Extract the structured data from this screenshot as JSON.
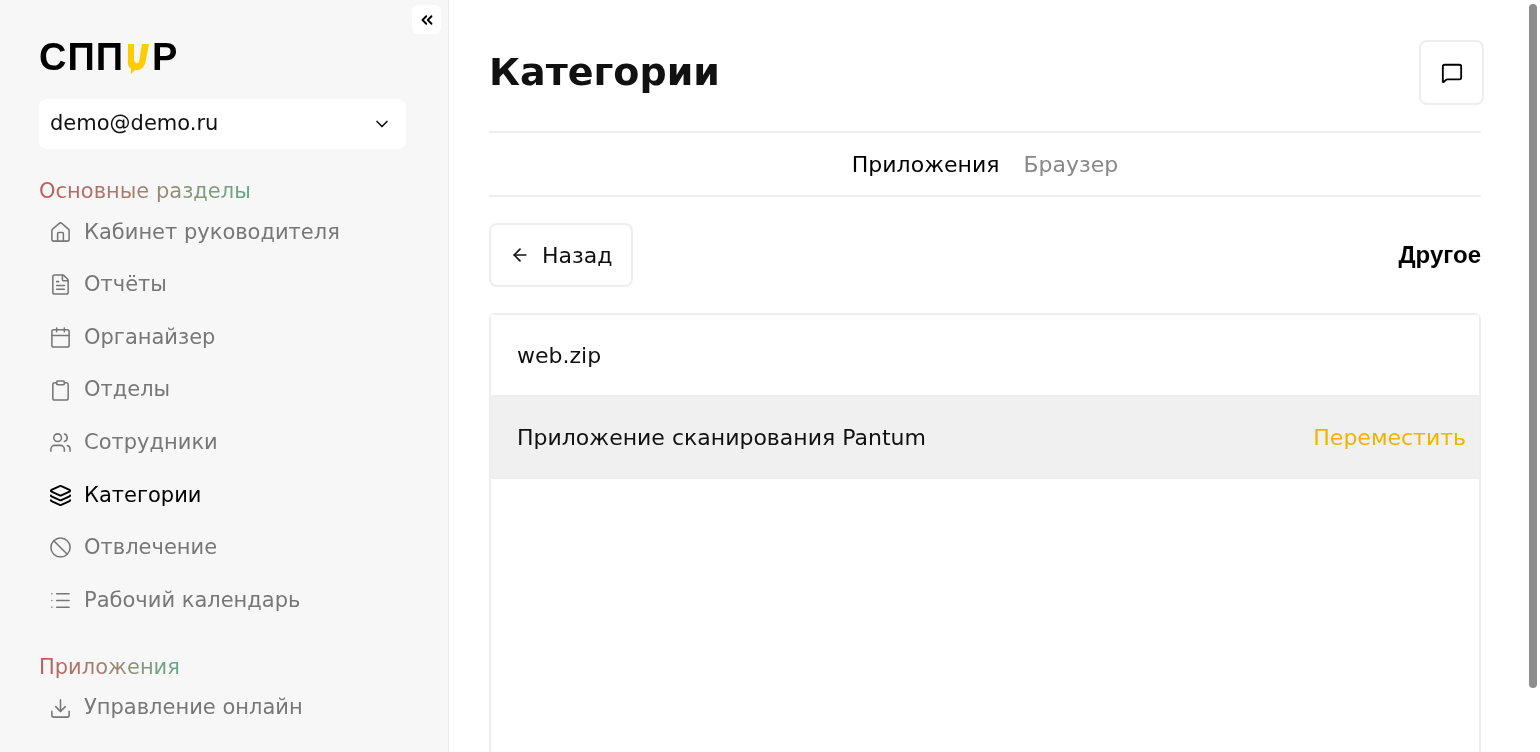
{
  "sidebar": {
    "logo": {
      "before": "СПП",
      "after": "Р"
    },
    "account": "demo@demo.ru",
    "sections": [
      {
        "title": "Основные разделы",
        "items": [
          {
            "kind": "home",
            "label": "Кабинет руководителя",
            "selected": false
          },
          {
            "kind": "report",
            "label": "Отчёты",
            "selected": false
          },
          {
            "kind": "calendar",
            "label": "Органайзер",
            "selected": false
          },
          {
            "kind": "clipboard",
            "label": "Отделы",
            "selected": false
          },
          {
            "kind": "users",
            "label": "Сотрудники",
            "selected": false
          },
          {
            "kind": "layers",
            "label": "Категории",
            "selected": true
          },
          {
            "kind": "ban",
            "label": "Отвлечение",
            "selected": false
          },
          {
            "kind": "list",
            "label": "Рабочий календарь",
            "selected": false
          }
        ]
      },
      {
        "title": "Приложения",
        "items": [
          {
            "kind": "download",
            "label": "Управление онлайн",
            "selected": false
          }
        ]
      }
    ]
  },
  "page": {
    "title": "Категории",
    "tabs": [
      {
        "label": "Приложения",
        "selected": true
      },
      {
        "label": "Браузер",
        "selected": false
      }
    ],
    "back_button": "Назад",
    "category": "Другое",
    "rows": [
      {
        "name": "web.zip",
        "highlighted": false
      },
      {
        "name": "Приложение сканирования Pantum",
        "highlighted": true,
        "action": "Переместить"
      }
    ]
  }
}
